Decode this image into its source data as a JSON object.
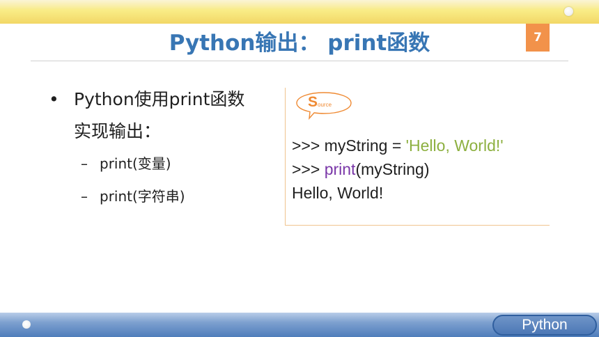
{
  "slide": {
    "title": "Python输出： print函数",
    "page_number": "7",
    "footer_label": "Python"
  },
  "bullets": {
    "main_symbol": "•",
    "main_text": "Python使用print函数实现输出：",
    "sub_symbol": "–",
    "sub_items": [
      "print(变量)",
      "print(字符串)"
    ]
  },
  "source_badge": {
    "big_letter": "S",
    "small_text": "ource"
  },
  "code": {
    "line1_prompt": ">>> myString = ",
    "line1_string": "'Hello, World!'",
    "line2_prompt": ">>> ",
    "line2_keyword": "print",
    "line2_rest": "(myString)",
    "line3_output": "Hello, World!"
  },
  "colors": {
    "title": "#3876b4",
    "badge": "#f2924a",
    "string": "#8db040",
    "keyword": "#7a37a8",
    "output": "#4a7fbd",
    "source_orange": "#ef8a33"
  }
}
